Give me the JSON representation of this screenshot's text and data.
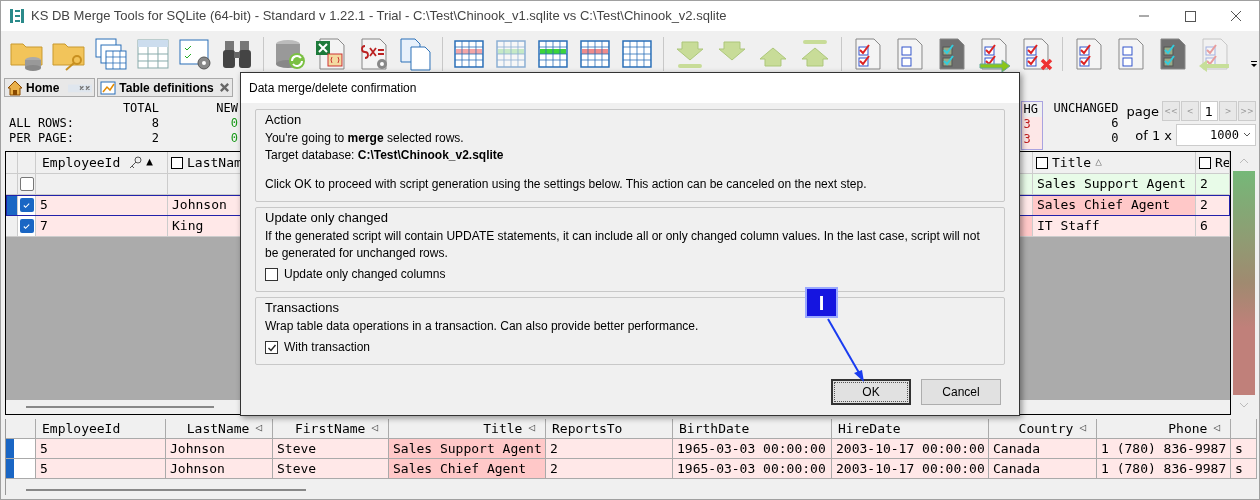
{
  "window": {
    "title": "KS DB Merge Tools for SQLite (64-bit) - Standard v 1.22.1 - Trial - C:\\Test\\Chinook_v1.sqlite vs C:\\Test\\Chinook_v2.sqlite"
  },
  "tabs": [
    {
      "label": "Home",
      "kind": "home"
    },
    {
      "label": "Table definitions",
      "kind": "definitions"
    }
  ],
  "summary": {
    "row_labels": [
      "ALL ROWS:",
      "PER PAGE:"
    ],
    "left_columns": [
      {
        "label": "TOTAL",
        "kind": "total",
        "values": [
          "8",
          "2"
        ]
      },
      {
        "label": "NEW",
        "kind": "new",
        "values": [
          "0",
          "0"
        ]
      }
    ],
    "right_columns": [
      {
        "label": "HG",
        "kind": "changed",
        "values": [
          "3",
          "3"
        ]
      },
      {
        "label": "UNCHANGED",
        "kind": "total",
        "values": [
          "6",
          "0"
        ]
      }
    ]
  },
  "pager": {
    "label": "page",
    "buttons": [
      {
        "label": "<<",
        "selected": false
      },
      {
        "label": "<",
        "selected": false
      },
      {
        "label": "1",
        "selected": true
      },
      {
        "label": ">",
        "selected": false
      },
      {
        "label": ">>",
        "selected": false
      }
    ],
    "of": "of 1 x",
    "page_size": "1000"
  },
  "top_grid": {
    "columns": [
      {
        "label": "EmployeeId",
        "key": true,
        "sort": "▲"
      },
      {
        "label": "LastNam",
        "checked": false
      },
      {
        "label": "Title",
        "checked": false,
        "sort": "△"
      },
      {
        "label": "Re",
        "checked": false
      }
    ],
    "rows": [
      {
        "checked": false,
        "selected": false,
        "kind": "source",
        "cells": {
          "title": "Sales Support Agent",
          "reports_to": "2"
        },
        "changed": {
          "column_3": false,
          "title": false
        }
      },
      {
        "checked": true,
        "selected": true,
        "kind": "target",
        "cells": {
          "employee_id": "5",
          "last_name": "Johnson",
          "title": "Sales Chief Agent",
          "reports_to": "2"
        },
        "changed": {
          "column_3": false,
          "title": true
        }
      },
      {
        "checked": true,
        "selected": false,
        "kind": "target",
        "cells": {
          "employee_id": "7",
          "last_name": "King",
          "title": "IT Staff",
          "reports_to": "6"
        },
        "changed": {
          "column_3": true,
          "title": false
        }
      }
    ]
  },
  "bottom_grid": {
    "columns": [
      {
        "label": "EmployeeId"
      },
      {
        "label": "LastName",
        "mark": "◁"
      },
      {
        "label": "FirstName",
        "mark": "◁"
      },
      {
        "label": "Title",
        "mark": "◁"
      },
      {
        "label": "ReportsTo"
      },
      {
        "label": "BirthDate"
      },
      {
        "label": "HireDate"
      },
      {
        "label": "Country",
        "mark": "◁"
      },
      {
        "label": "Phone",
        "mark": "◁"
      }
    ],
    "rows": [
      {
        "cells": [
          "5",
          "Johnson",
          "Steve",
          "Sales Support Agent",
          "2",
          "1965-03-03 00:00:00",
          "2003-10-17 00:00:00",
          "Canada",
          "1 (780) 836-9987",
          "s"
        ],
        "title_changed": true
      },
      {
        "cells": [
          "5",
          "Johnson",
          "Steve",
          "Sales Chief Agent",
          "2",
          "1965-03-03 00:00:00",
          "2003-10-17 00:00:00",
          "Canada",
          "1 (780) 836-9987",
          "s"
        ],
        "title_changed": true
      }
    ]
  },
  "dialog": {
    "title": "Data merge/delete confirmation",
    "groups": [
      {
        "title": "Action",
        "lines": [
          "You're going to **merge** selected rows.",
          "Target database: **C:\\Test\\Chinook_v2.sqlite**",
          "Click OK to proceed with script generation using the settings below. This action can be canceled on the next step."
        ]
      },
      {
        "title": "Update only changed",
        "lines": [
          "If the generated script will contain UPDATE statements, it can include all or only changed column values. In the last case, script will not be generated for unchanged rows."
        ],
        "checkbox": {
          "label": "Update only changed columns",
          "checked": false
        }
      },
      {
        "title": "Transactions",
        "lines": [
          "Wrap table data operations in a transaction. Can also provide better performance."
        ],
        "checkbox": {
          "label": "With transaction",
          "checked": true
        }
      }
    ],
    "buttons": [
      {
        "label": "OK",
        "default": true
      },
      {
        "label": "Cancel",
        "default": false
      }
    ]
  },
  "annotation": {
    "label": "I"
  }
}
